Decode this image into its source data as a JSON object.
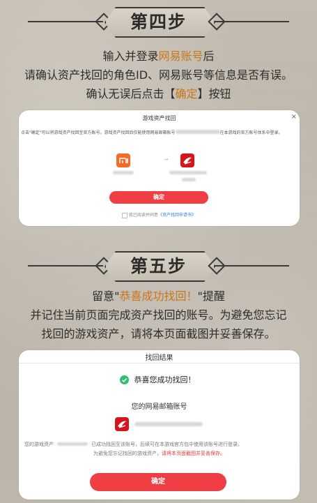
{
  "step4": {
    "title": "第四步",
    "line1_prefix": "输入并登录",
    "line1_highlight": "网易账号",
    "line1_suffix": "后",
    "line2": "请确认资产找回的角色ID、网易账号等信息是否有误。",
    "line3_prefix": "确认无误后点击【",
    "line3_highlight": "确定",
    "line3_suffix": "】按钮"
  },
  "dialog": {
    "title": "游戏资产找回",
    "close": "×",
    "body_part1": "点击\"确定\"可以将游戏资产找回至官方账号。游戏资产找回后仅能使用网易邮箱账号",
    "body_part2": "在本游戏的官方账号体系中登录。",
    "arrow": "→",
    "confirm": "确定",
    "checkbox_label": "我已阅读并同意",
    "agreement_link": "《资产找回申请书》"
  },
  "step5": {
    "title": "第五步",
    "line1_prefix": "留意\"",
    "line1_highlight": "恭喜成功找回！",
    "line1_suffix": "\"提醒",
    "line2": "并记住当前页面完成资产找回的账号。为避免您忘记",
    "line3": "找回的游戏资产，请将本页面截图并妥善保存。"
  },
  "result": {
    "title": "找回结果",
    "success": "恭喜您成功找回！",
    "account_label": "您的网易邮箱账号",
    "info_prefix": "您的游戏资产",
    "info_mid": "已成功找回至该账号，后续可在本游戏官方包中使用该账号进行登录。",
    "info2_prefix": "为避免您忘记找回的游戏资产，",
    "info2_red": "请将本页面截图并妥善保存。",
    "confirm": "确定"
  },
  "colors": {
    "accent_orange": "#c9761a",
    "red": "#ef3f45",
    "green": "#2fbf71"
  }
}
